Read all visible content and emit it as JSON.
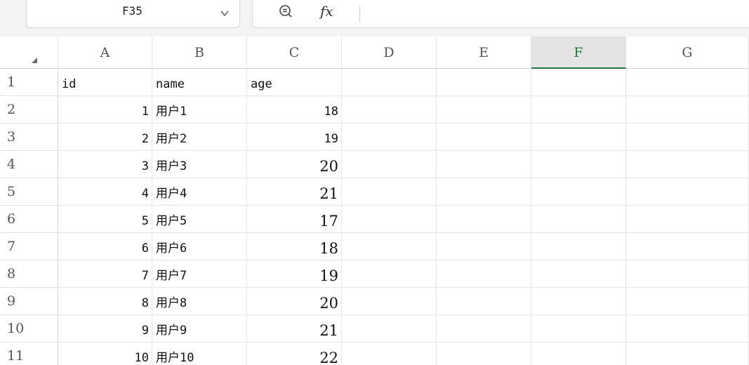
{
  "name_box": {
    "value": "F35"
  },
  "formula_bar": {
    "fx_label": "fx",
    "value": ""
  },
  "columns": [
    {
      "label": "A",
      "selected": false
    },
    {
      "label": "B",
      "selected": false
    },
    {
      "label": "C",
      "selected": false
    },
    {
      "label": "D",
      "selected": false
    },
    {
      "label": "E",
      "selected": false
    },
    {
      "label": "F",
      "selected": true
    },
    {
      "label": "G",
      "selected": false
    }
  ],
  "rows": [
    {
      "num": "1",
      "cells": [
        "id",
        "name",
        "age",
        "",
        "",
        "",
        ""
      ]
    },
    {
      "num": "2",
      "cells": [
        "1",
        "用户1",
        "18",
        "",
        "",
        "",
        ""
      ]
    },
    {
      "num": "3",
      "cells": [
        "2",
        "用户2",
        "19",
        "",
        "",
        "",
        ""
      ]
    },
    {
      "num": "4",
      "cells": [
        "3",
        "用户3",
        "20",
        "",
        "",
        "",
        ""
      ]
    },
    {
      "num": "5",
      "cells": [
        "4",
        "用户4",
        "21",
        "",
        "",
        "",
        ""
      ]
    },
    {
      "num": "6",
      "cells": [
        "5",
        "用户5",
        "17",
        "",
        "",
        "",
        ""
      ]
    },
    {
      "num": "7",
      "cells": [
        "6",
        "用户6",
        "18",
        "",
        "",
        "",
        ""
      ]
    },
    {
      "num": "8",
      "cells": [
        "7",
        "用户7",
        "19",
        "",
        "",
        "",
        ""
      ]
    },
    {
      "num": "9",
      "cells": [
        "8",
        "用户8",
        "20",
        "",
        "",
        "",
        ""
      ]
    },
    {
      "num": "10",
      "cells": [
        "9",
        "用户9",
        "21",
        "",
        "",
        "",
        ""
      ]
    },
    {
      "num": "11",
      "cells": [
        "10",
        "用户10",
        "22",
        "",
        "",
        "",
        ""
      ]
    }
  ],
  "icons": {
    "dropdown": "chevron-down-icon",
    "zoom_formula": "zoom-formula-icon",
    "fx": "fx-icon",
    "select_all": "select-all-triangle-icon"
  },
  "colors": {
    "selected_column_accent": "#1e7c40",
    "selected_column_bg": "#e4e4e4",
    "toolbar_bg": "#f3f3f3"
  }
}
